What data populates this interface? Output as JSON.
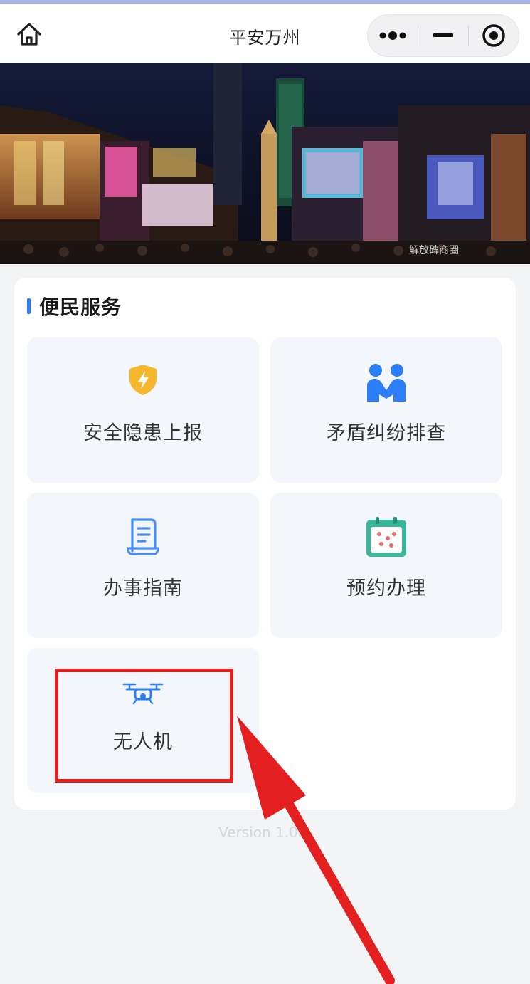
{
  "header": {
    "title": "平安万州",
    "home_icon": "home-icon",
    "capsule": [
      "more-icon",
      "minimize-icon",
      "close-target-icon"
    ]
  },
  "banner": {
    "watermark": "解放碑商圈"
  },
  "services": {
    "title": "便民服务",
    "accent": "#2d7ff9",
    "items": [
      {
        "label": "安全隐患上报",
        "icon": "shield-lightning-icon"
      },
      {
        "label": "矛盾纠纷排查",
        "icon": "people-handshake-icon"
      },
      {
        "label": "办事指南",
        "icon": "document-guide-icon"
      },
      {
        "label": "预约办理",
        "icon": "calendar-icon"
      },
      {
        "label": "无人机",
        "icon": "drone-icon"
      }
    ]
  },
  "footer": {
    "version": "Version 1.0.4"
  },
  "annotation": {
    "color": "#e41f1f",
    "target": "无人机"
  }
}
